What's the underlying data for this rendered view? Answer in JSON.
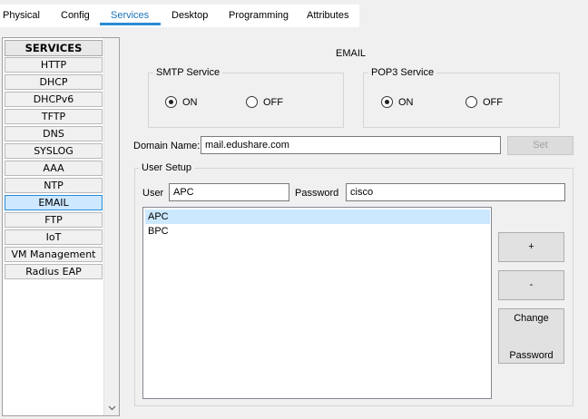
{
  "tabs": [
    {
      "label": "Physical"
    },
    {
      "label": "Config"
    },
    {
      "label": "Services"
    },
    {
      "label": "Desktop"
    },
    {
      "label": "Programming"
    },
    {
      "label": "Attributes"
    }
  ],
  "active_tab": "Services",
  "services": {
    "header": "SERVICES",
    "items": [
      {
        "label": "HTTP"
      },
      {
        "label": "DHCP"
      },
      {
        "label": "DHCPv6"
      },
      {
        "label": "TFTP"
      },
      {
        "label": "DNS"
      },
      {
        "label": "SYSLOG"
      },
      {
        "label": "AAA"
      },
      {
        "label": "NTP"
      },
      {
        "label": "EMAIL"
      },
      {
        "label": "FTP"
      },
      {
        "label": "IoT"
      },
      {
        "label": "VM Management"
      },
      {
        "label": "Radius EAP"
      }
    ],
    "selected": "EMAIL"
  },
  "email": {
    "title": "EMAIL",
    "smtp": {
      "legend": "SMTP Service",
      "on_label": "ON",
      "off_label": "OFF",
      "selected": "ON"
    },
    "pop3": {
      "legend": "POP3 Service",
      "on_label": "ON",
      "off_label": "OFF",
      "selected": "ON"
    },
    "domain_label": "Domain Name:",
    "domain_value": "mail.edushare.com",
    "set_label": "Set",
    "user_setup": {
      "legend": "User Setup",
      "user_label": "User",
      "user_value": "APC",
      "password_label": "Password",
      "password_value": "cisco",
      "users": [
        "APC",
        "BPC"
      ],
      "selected_user": "APC",
      "add_label": "+",
      "remove_label": "-",
      "change_label_1": "Change",
      "change_label_2": "Password"
    }
  }
}
